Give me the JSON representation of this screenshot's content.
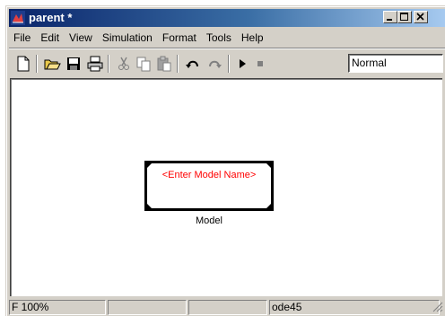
{
  "window": {
    "title": "parent *"
  },
  "menu": {
    "items": [
      "File",
      "Edit",
      "View",
      "Simulation",
      "Format",
      "Tools",
      "Help"
    ]
  },
  "toolbar": {
    "icons": [
      "new-icon",
      "open-icon",
      "save-icon",
      "print-icon",
      "cut-icon",
      "copy-icon",
      "paste-icon",
      "undo-icon",
      "redo-icon",
      "start-icon",
      "stop-icon"
    ],
    "mode_value": "Normal"
  },
  "canvas": {
    "block_text": "<Enter Model Name>",
    "block_text_color": "#ff0000",
    "block_label": "Model"
  },
  "status": {
    "cell1": "F 100%",
    "cell2": "",
    "cell3": "",
    "cell4": "ode45"
  },
  "colors": {
    "title_start": "#0a246a",
    "title_end": "#a6caf0",
    "chrome": "#d4d0c8"
  }
}
